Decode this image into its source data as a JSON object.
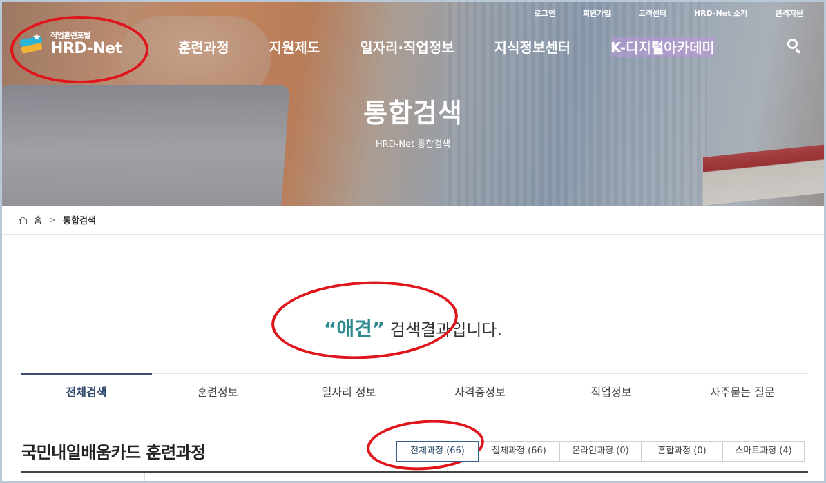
{
  "util_nav": [
    "로그인",
    "회원가입",
    "고객센터",
    "HRD-Net 소개",
    "원격지원"
  ],
  "logo": {
    "sub": "직업훈련포털",
    "main": "HRD-Net"
  },
  "gnb": [
    "훈련과정",
    "지원제도",
    "일자리·직업정보",
    "지식정보센터",
    "K-디지털아카데미"
  ],
  "hero": {
    "title": "통합검색",
    "subtitle": "HRD-Net 통합검색"
  },
  "breadcrumb": {
    "home": "홈",
    "current": "통합검색"
  },
  "result": {
    "open_quote": "“",
    "keyword": "애견",
    "close_quote": "”",
    "suffix": " 검색결과입니다."
  },
  "tabs": [
    "전체검색",
    "훈련정보",
    "일자리 정보",
    "자격증정보",
    "직업정보",
    "자주묻는 질문"
  ],
  "section": {
    "title": "국민내일배움카드 훈련과정",
    "filters": [
      "전체과정 (66)",
      "집체과정 (66)",
      "온라인과정 (0)",
      "혼합과정 (0)",
      "스마트과정 (4)"
    ]
  },
  "colors": {
    "keyword": "#2f8a8f",
    "annotation": "#e0141b",
    "active_tab": "#3a4f6d"
  }
}
